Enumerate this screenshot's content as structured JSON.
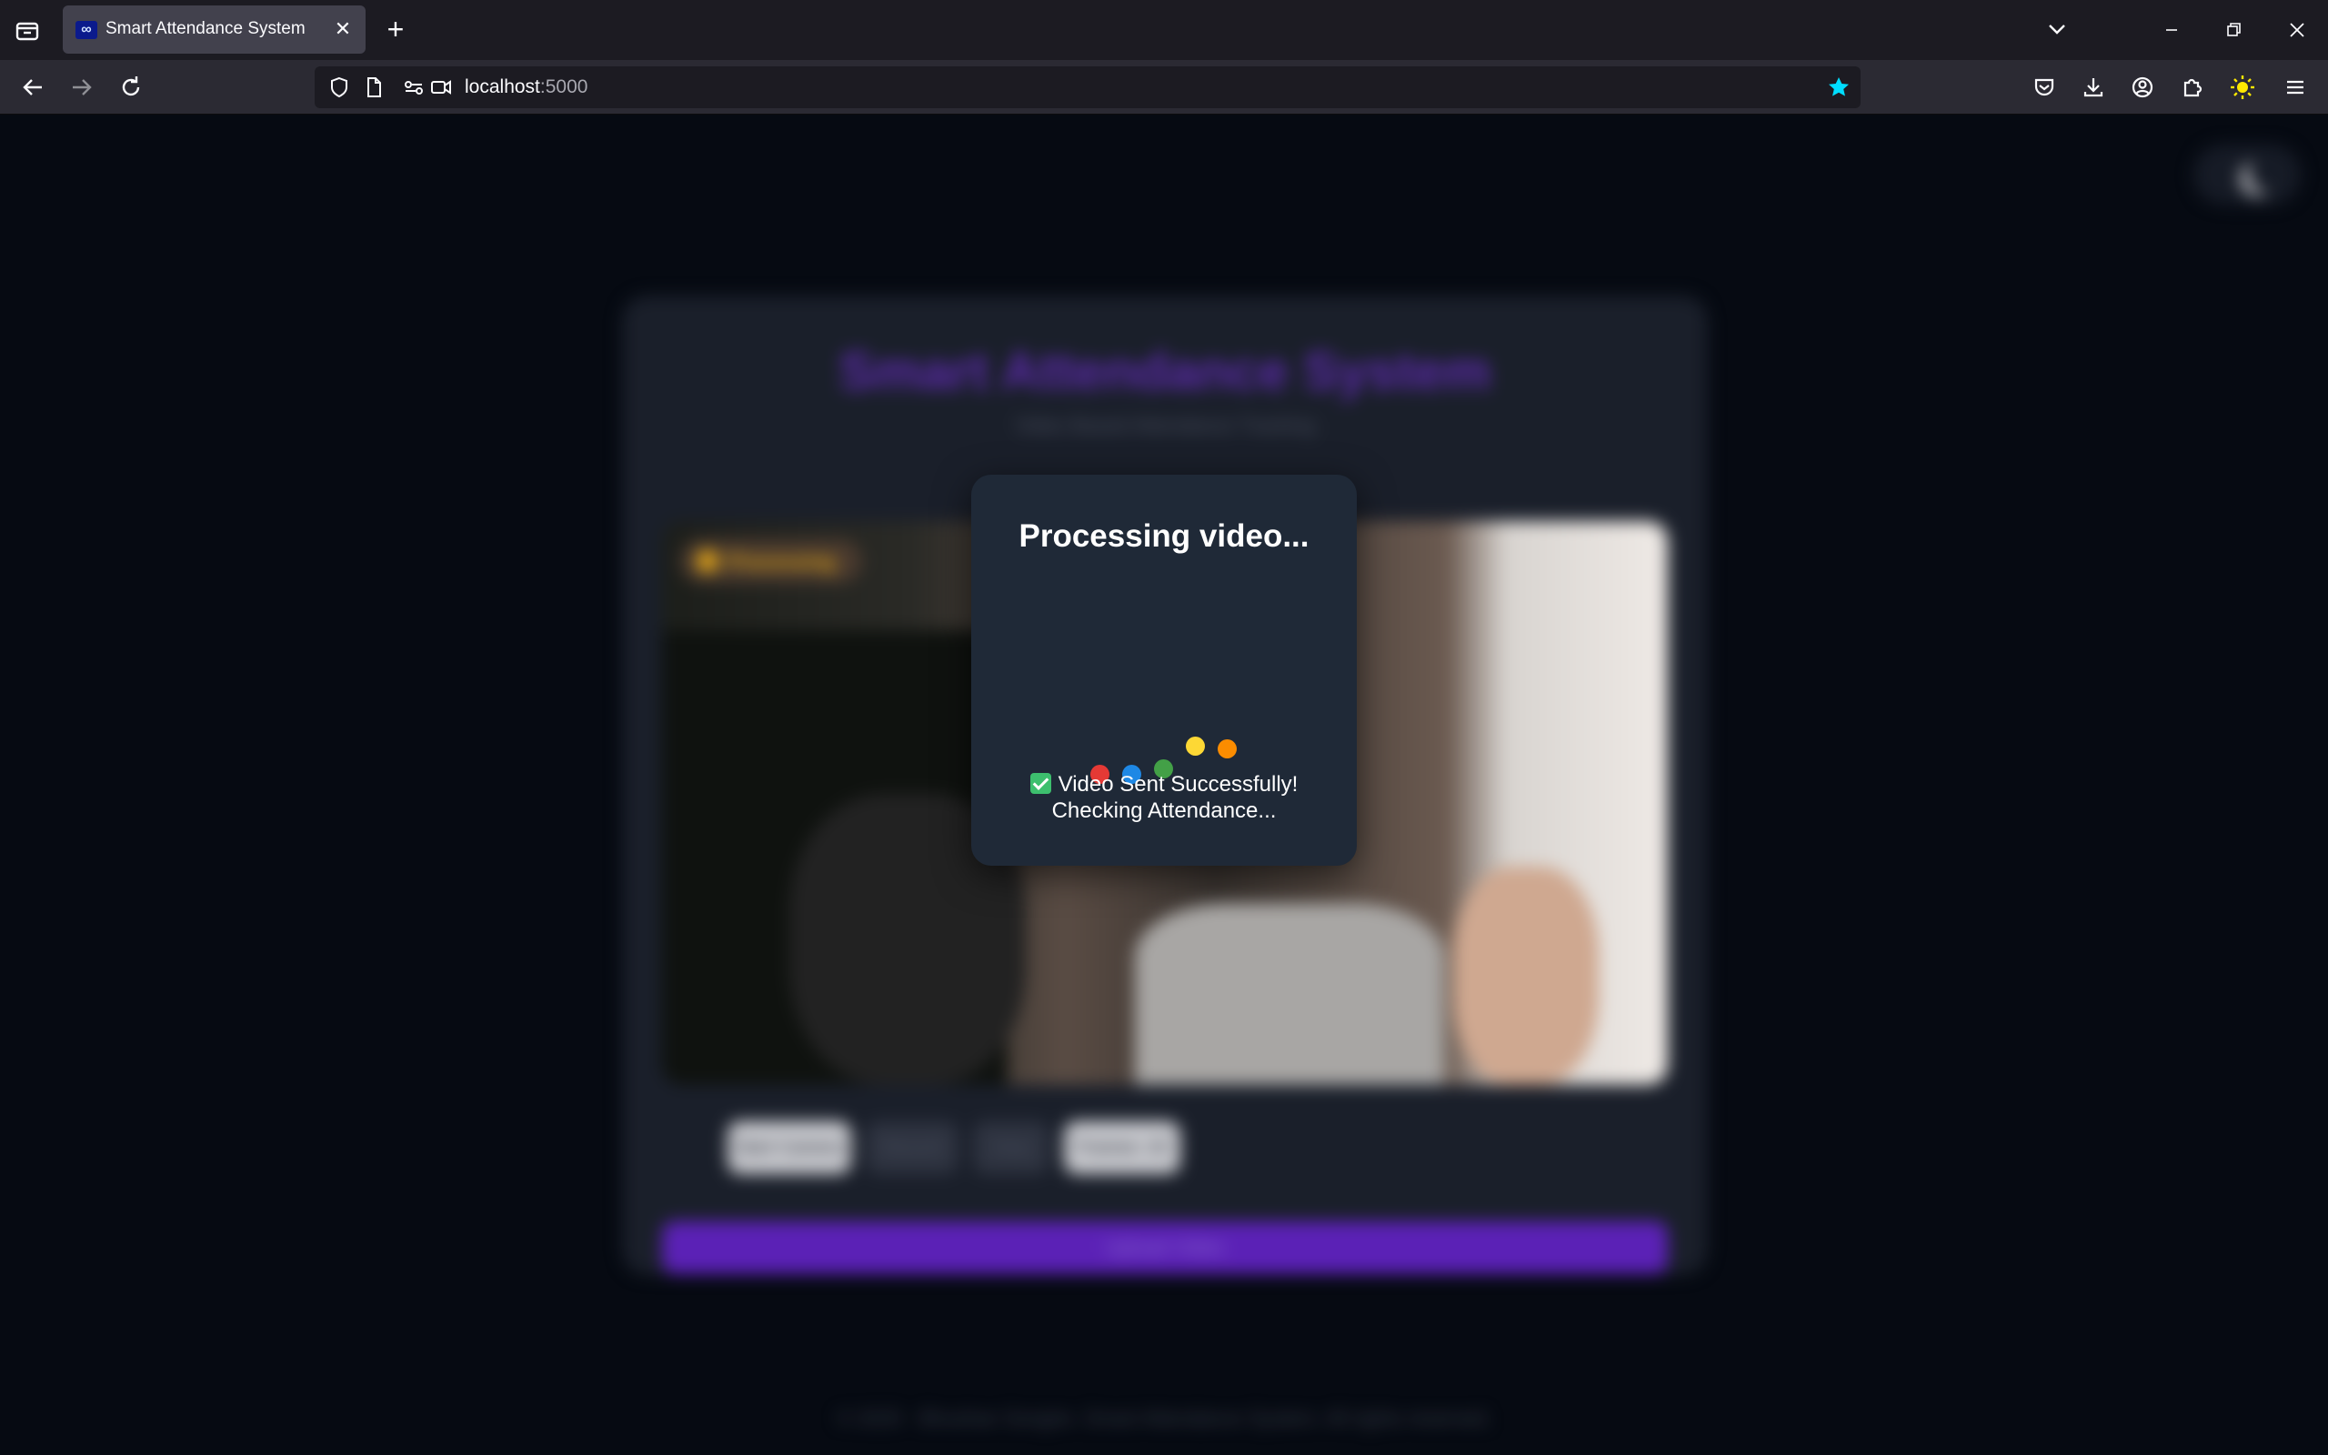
{
  "browser": {
    "tab_title": "Smart Attendance System",
    "tab_close": "✕",
    "new_tab": "+",
    "url_host": "localhost",
    "url_port": ":5000"
  },
  "page": {
    "app_title": "Smart Attendance System",
    "app_subtitle": "Video Based Attendance Tracking",
    "video_status": "Processing",
    "buttons": {
      "start_camera": "Start Camera",
      "record": "Record",
      "stop": "Stop",
      "frames": "Frames: 20"
    },
    "upload_label": "Upload Video",
    "footer": "© 2025 · Bhushan Songire. Smart Attendance System. All rights reserved."
  },
  "modal": {
    "title": "Processing video...",
    "message_line1": "Video Sent Successfully!",
    "message_line2": "Checking Attendance...",
    "dot_colors": [
      "#e53935",
      "#1e88e5",
      "#43a047",
      "#fdd835",
      "#fb8c00"
    ]
  },
  "colors": {
    "accent": "#5b21b6",
    "modal_bg": "#1f2937",
    "success": "#3dbf6e"
  }
}
